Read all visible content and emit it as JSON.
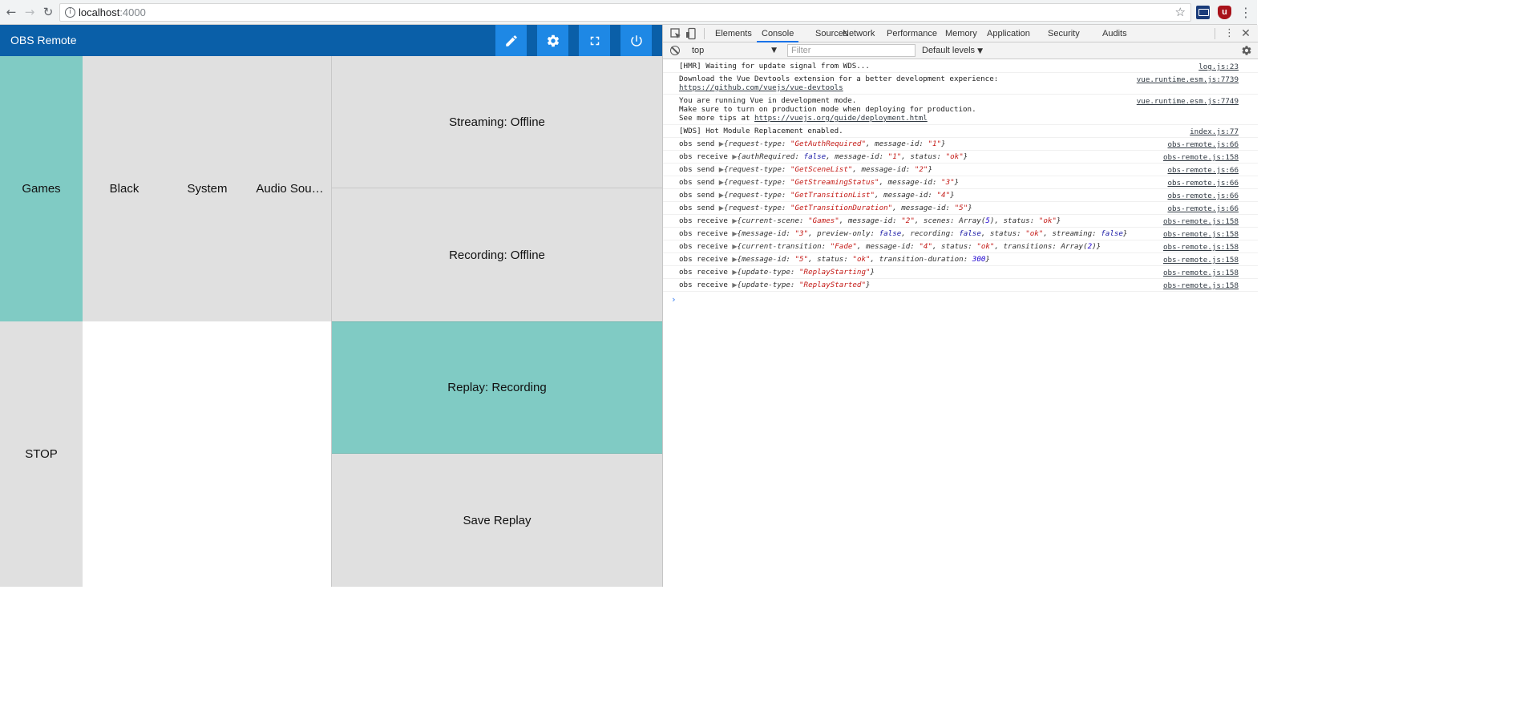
{
  "browser": {
    "url_host": "localhost",
    "url_port": ":4000",
    "icons": {
      "back": "back-arrow-icon",
      "forward": "forward-arrow-icon",
      "reload": "reload-icon",
      "info": "info-icon",
      "bookmark": "star-icon",
      "menu": "kebab-menu-icon"
    }
  },
  "app": {
    "title": "OBS Remote",
    "accent_color": "#80cbc4",
    "bar_color": "#0a5fa8",
    "toolbar_buttons": [
      "edit-icon",
      "gear-icon",
      "fullscreen-icon",
      "power-icon"
    ],
    "scenes": {
      "current": "Games",
      "top_row": [
        "Black",
        "System",
        "Audio Sou…"
      ],
      "stop_label": "STOP"
    },
    "status": {
      "streaming": "Streaming: Offline",
      "recording": "Recording: Offline",
      "replay": "Replay: Recording",
      "save_replay": "Save Replay"
    }
  },
  "devtools": {
    "tabs": [
      "Elements",
      "Console",
      "Sources",
      "Network",
      "Performance",
      "Memory",
      "Application",
      "Security",
      "Audits"
    ],
    "selected_tab": "Console",
    "context": "top",
    "filter_placeholder": "Filter",
    "levels": "Default levels",
    "messages": [
      {
        "lines": [
          "[HMR] Waiting for update signal from WDS..."
        ],
        "source": "log.js:23"
      },
      {
        "lines": [
          "Download the Vue Devtools extension for a better development experience:",
          "https://github.com/vuejs/vue-devtools"
        ],
        "source": "vue.runtime.esm.js:7739"
      },
      {
        "lines": [
          "You are running Vue in development mode.",
          "Make sure to turn on production mode when deploying for production.",
          "See more tips at https://vuejs.org/guide/deployment.html"
        ],
        "source": "vue.runtime.esm.js:7749"
      },
      {
        "lines": [
          "[WDS] Hot Module Replacement enabled."
        ],
        "source": "index.js:77"
      },
      {
        "prefix": "obs send ",
        "object": "{request-type: \"GetAuthRequired\", message-id: \"1\"}",
        "source": "obs-remote.js:66"
      },
      {
        "prefix": "obs receive ",
        "object": "{authRequired: false, message-id: \"1\", status: \"ok\"}",
        "source": "obs-remote.js:158"
      },
      {
        "prefix": "obs send ",
        "object": "{request-type: \"GetSceneList\", message-id: \"2\"}",
        "source": "obs-remote.js:66"
      },
      {
        "prefix": "obs send ",
        "object": "{request-type: \"GetStreamingStatus\", message-id: \"3\"}",
        "source": "obs-remote.js:66"
      },
      {
        "prefix": "obs send ",
        "object": "{request-type: \"GetTransitionList\", message-id: \"4\"}",
        "source": "obs-remote.js:66"
      },
      {
        "prefix": "obs send ",
        "object": "{request-type: \"GetTransitionDuration\", message-id: \"5\"}",
        "source": "obs-remote.js:66"
      },
      {
        "prefix": "obs receive ",
        "object": "{current-scene: \"Games\", message-id: \"2\", scenes: Array(5), status: \"ok\"}",
        "source": "obs-remote.js:158"
      },
      {
        "prefix": "obs receive ",
        "object": "{message-id: \"3\", preview-only: false, recording: false, status: \"ok\", streaming: false}",
        "source": "obs-remote.js:158"
      },
      {
        "prefix": "obs receive ",
        "object": "{current-transition: \"Fade\", message-id: \"4\", status: \"ok\", transitions: Array(2)}",
        "source": "obs-remote.js:158"
      },
      {
        "prefix": "obs receive ",
        "object": "{message-id: \"5\", status: \"ok\", transition-duration: 300}",
        "source": "obs-remote.js:158"
      },
      {
        "prefix": "obs receive ",
        "object": "{update-type: \"ReplayStarting\"}",
        "source": "obs-remote.js:158"
      },
      {
        "prefix": "obs receive ",
        "object": "{update-type: \"ReplayStarted\"}",
        "source": "obs-remote.js:158"
      }
    ]
  }
}
